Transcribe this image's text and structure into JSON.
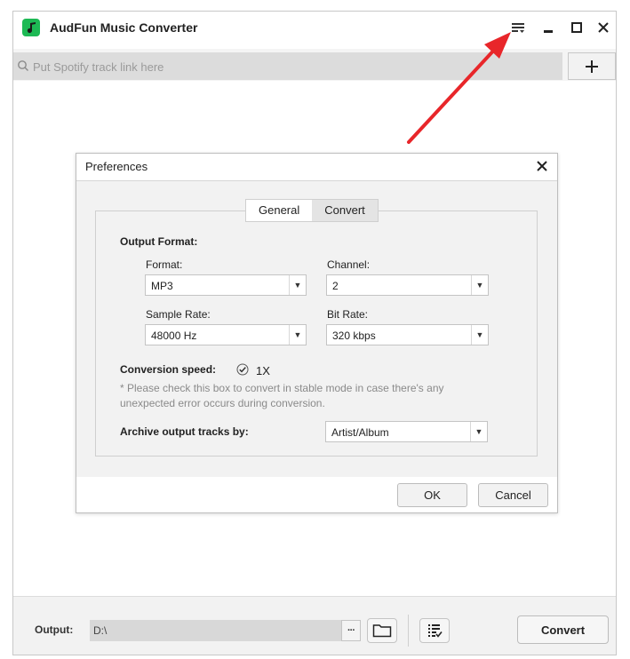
{
  "window": {
    "title": "AudFun Music Converter"
  },
  "search": {
    "placeholder": "Put Spotify track link here"
  },
  "preferences": {
    "title": "Preferences",
    "tabs": [
      {
        "label": "General"
      },
      {
        "label": "Convert"
      }
    ],
    "output_format_label": "Output Format:",
    "format": {
      "label": "Format:",
      "value": "MP3"
    },
    "channel": {
      "label": "Channel:",
      "value": "2"
    },
    "sample_rate": {
      "label": "Sample Rate:",
      "value": "48000 Hz"
    },
    "bit_rate": {
      "label": "Bit Rate:",
      "value": "320 kbps"
    },
    "conversion_speed": {
      "label": "Conversion speed:",
      "value": "1X",
      "checked": true
    },
    "note_line1": "* Please check this box to convert in stable mode in case there's any",
    "note_line2": "unexpected error occurs during conversion.",
    "archive": {
      "label": "Archive output tracks by:",
      "value": "Artist/Album"
    },
    "ok_label": "OK",
    "cancel_label": "Cancel"
  },
  "bottom": {
    "output_label": "Output:",
    "output_path": "D:\\",
    "more_label": "···",
    "convert_label": "Convert"
  },
  "colors": {
    "logo_green": "#1db954",
    "annotation_red": "#e8262a"
  }
}
